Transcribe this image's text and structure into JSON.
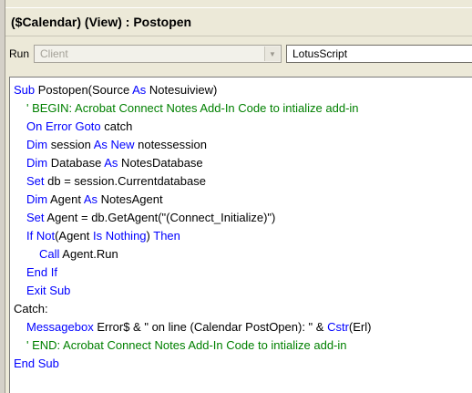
{
  "window": {
    "title": "($Calendar) (View) : Postopen"
  },
  "run_bar": {
    "run_label": "Run",
    "client_value": "Client",
    "language_value": "LotusScript"
  },
  "colors": {
    "keyword": "#0000ff",
    "comment": "#008000",
    "text": "#000000"
  },
  "code_lines": [
    {
      "indent": 0,
      "tokens": [
        {
          "t": "kw",
          "v": "Sub "
        },
        {
          "t": "tx",
          "v": "Postopen(Source "
        },
        {
          "t": "kw",
          "v": "As"
        },
        {
          "t": "tx",
          "v": " Notesuiview)"
        }
      ]
    },
    {
      "indent": 1,
      "tokens": [
        {
          "t": "cm",
          "v": "' BEGIN: Acrobat Connect Notes Add-In Code to intialize add-in"
        }
      ]
    },
    {
      "indent": 1,
      "tokens": [
        {
          "t": "kw",
          "v": "On Error Goto"
        },
        {
          "t": "tx",
          "v": " catch"
        }
      ]
    },
    {
      "indent": 1,
      "tokens": [
        {
          "t": "kw",
          "v": "Dim"
        },
        {
          "t": "tx",
          "v": " session "
        },
        {
          "t": "kw",
          "v": "As New"
        },
        {
          "t": "tx",
          "v": " notessession"
        }
      ]
    },
    {
      "indent": 1,
      "tokens": [
        {
          "t": "kw",
          "v": "Dim"
        },
        {
          "t": "tx",
          "v": " Database "
        },
        {
          "t": "kw",
          "v": "As"
        },
        {
          "t": "tx",
          "v": " NotesDatabase"
        }
      ]
    },
    {
      "indent": 1,
      "tokens": [
        {
          "t": "kw",
          "v": "Set"
        },
        {
          "t": "tx",
          "v": " db = session.Currentdatabase"
        }
      ]
    },
    {
      "indent": 1,
      "tokens": [
        {
          "t": "kw",
          "v": "Dim"
        },
        {
          "t": "tx",
          "v": " Agent "
        },
        {
          "t": "kw",
          "v": "As"
        },
        {
          "t": "tx",
          "v": " NotesAgent"
        }
      ]
    },
    {
      "indent": 1,
      "tokens": [
        {
          "t": "kw",
          "v": "Set"
        },
        {
          "t": "tx",
          "v": " Agent = db.GetAgent(\"(Connect_Initialize)\")"
        }
      ]
    },
    {
      "indent": 1,
      "tokens": [
        {
          "t": "kw",
          "v": "If Not"
        },
        {
          "t": "tx",
          "v": "(Agent "
        },
        {
          "t": "kw",
          "v": "Is Nothing"
        },
        {
          "t": "tx",
          "v": ") "
        },
        {
          "t": "kw",
          "v": "Then"
        }
      ]
    },
    {
      "indent": 2,
      "tokens": [
        {
          "t": "kw",
          "v": "Call"
        },
        {
          "t": "tx",
          "v": " Agent.Run"
        }
      ]
    },
    {
      "indent": 1,
      "tokens": [
        {
          "t": "kw",
          "v": "End If"
        }
      ]
    },
    {
      "indent": 1,
      "tokens": [
        {
          "t": "kw",
          "v": "Exit Sub"
        }
      ]
    },
    {
      "indent": 0,
      "tokens": [
        {
          "t": "tx",
          "v": "Catch:"
        }
      ]
    },
    {
      "indent": 1,
      "tokens": [
        {
          "t": "kw",
          "v": "Messagebox"
        },
        {
          "t": "tx",
          "v": " Error$ & \" on line (Calendar PostOpen): \" & "
        },
        {
          "t": "kw",
          "v": "Cstr"
        },
        {
          "t": "tx",
          "v": "(Erl)"
        }
      ]
    },
    {
      "indent": 1,
      "tokens": [
        {
          "t": "cm",
          "v": "' END: Acrobat Connect Notes Add-In Code to intialize add-in"
        }
      ]
    },
    {
      "indent": 0,
      "tokens": [
        {
          "t": "kw",
          "v": "End Sub"
        }
      ]
    }
  ]
}
